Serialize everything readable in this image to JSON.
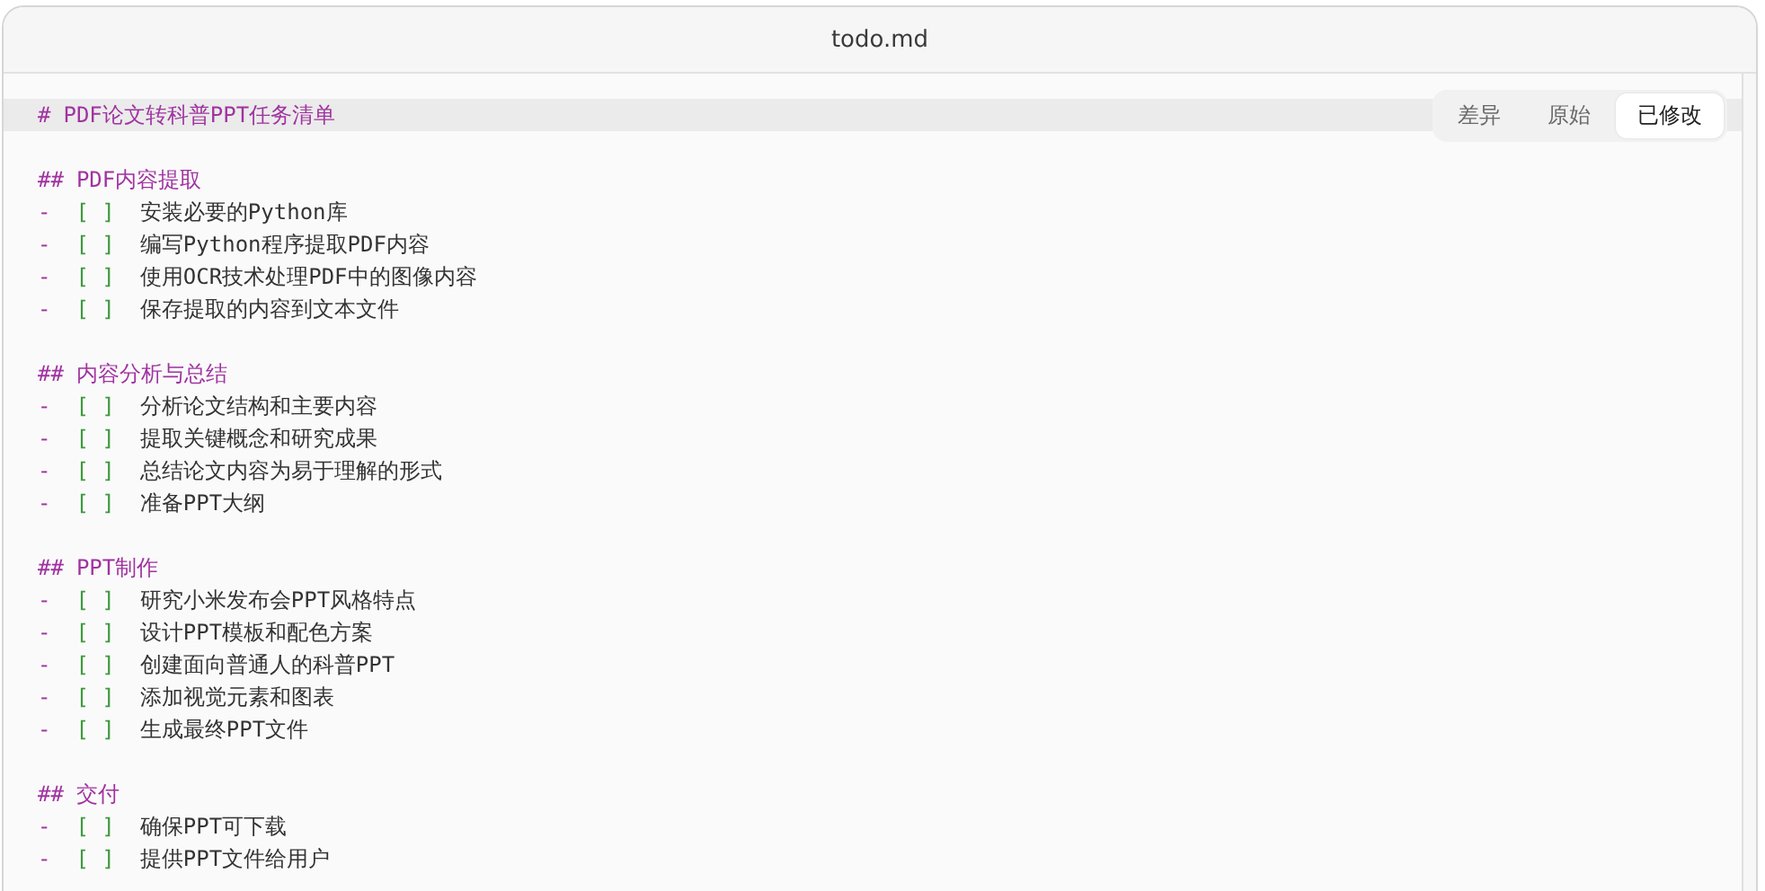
{
  "window": {
    "title": "todo.md"
  },
  "view_tabs": [
    {
      "label": "差异",
      "selected": false
    },
    {
      "label": "原始",
      "selected": false
    },
    {
      "label": "已修改",
      "selected": true
    }
  ],
  "editor": {
    "lines": [
      {
        "kind": "heading",
        "marker": "#",
        "text": "PDF论文转科普PPT任务清单",
        "highlighted": true
      },
      {
        "kind": "blank",
        "highlighted": false
      },
      {
        "kind": "heading",
        "marker": "##",
        "text": "PDF内容提取",
        "highlighted": false
      },
      {
        "kind": "task",
        "bullet": "-",
        "box": "[ ]",
        "text": "安装必要的Python库",
        "highlighted": false
      },
      {
        "kind": "task",
        "bullet": "-",
        "box": "[ ]",
        "text": "编写Python程序提取PDF内容",
        "highlighted": false
      },
      {
        "kind": "task",
        "bullet": "-",
        "box": "[ ]",
        "text": "使用OCR技术处理PDF中的图像内容",
        "highlighted": false
      },
      {
        "kind": "task",
        "bullet": "-",
        "box": "[ ]",
        "text": "保存提取的内容到文本文件",
        "highlighted": false
      },
      {
        "kind": "blank",
        "highlighted": false
      },
      {
        "kind": "heading",
        "marker": "##",
        "text": "内容分析与总结",
        "highlighted": false
      },
      {
        "kind": "task",
        "bullet": "-",
        "box": "[ ]",
        "text": "分析论文结构和主要内容",
        "highlighted": false
      },
      {
        "kind": "task",
        "bullet": "-",
        "box": "[ ]",
        "text": "提取关键概念和研究成果",
        "highlighted": false
      },
      {
        "kind": "task",
        "bullet": "-",
        "box": "[ ]",
        "text": "总结论文内容为易于理解的形式",
        "highlighted": false
      },
      {
        "kind": "task",
        "bullet": "-",
        "box": "[ ]",
        "text": "准备PPT大纲",
        "highlighted": false
      },
      {
        "kind": "blank",
        "highlighted": false
      },
      {
        "kind": "heading",
        "marker": "##",
        "text": "PPT制作",
        "highlighted": false
      },
      {
        "kind": "task",
        "bullet": "-",
        "box": "[ ]",
        "text": "研究小米发布会PPT风格特点",
        "highlighted": false
      },
      {
        "kind": "task",
        "bullet": "-",
        "box": "[ ]",
        "text": "设计PPT模板和配色方案",
        "highlighted": false
      },
      {
        "kind": "task",
        "bullet": "-",
        "box": "[ ]",
        "text": "创建面向普通人的科普PPT",
        "highlighted": false
      },
      {
        "kind": "task",
        "bullet": "-",
        "box": "[ ]",
        "text": "添加视觉元素和图表",
        "highlighted": false
      },
      {
        "kind": "task",
        "bullet": "-",
        "box": "[ ]",
        "text": "生成最终PPT文件",
        "highlighted": false
      },
      {
        "kind": "blank",
        "highlighted": false
      },
      {
        "kind": "heading",
        "marker": "##",
        "text": "交付",
        "highlighted": false
      },
      {
        "kind": "task",
        "bullet": "-",
        "box": "[ ]",
        "text": "确保PPT可下载",
        "highlighted": false
      },
      {
        "kind": "task",
        "bullet": "-",
        "box": "[ ]",
        "text": "提供PPT文件给用户",
        "highlighted": false
      }
    ]
  }
}
